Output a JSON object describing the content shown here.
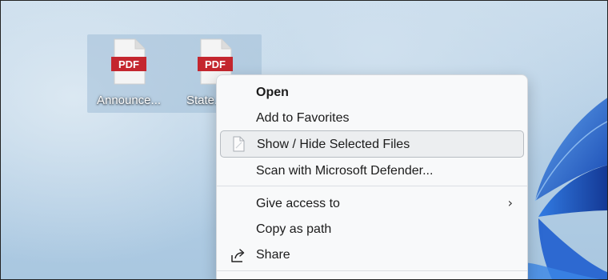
{
  "desktop": {
    "icons": [
      {
        "label": "Announce...",
        "type_label": "PDF"
      },
      {
        "label": "State...",
        "type_label": "PDF"
      }
    ]
  },
  "context_menu": {
    "items": [
      {
        "label": "Open",
        "bold": true
      },
      {
        "label": "Add to Favorites"
      },
      {
        "label": "Show / Hide Selected Files",
        "hovered": true,
        "icon": "file-icon"
      },
      {
        "label": "Scan with Microsoft Defender..."
      },
      {
        "label": "Give access to",
        "submenu": true
      },
      {
        "label": "Copy as path"
      },
      {
        "label": "Share",
        "icon": "share-icon"
      }
    ],
    "submenu_chevron": "›"
  },
  "colors": {
    "pdf_red": "#c4262e",
    "menu_bg": "#f8f9fa",
    "hover_bg": "#eceef0",
    "wallpaper_bloom": "#1a5fd0"
  }
}
